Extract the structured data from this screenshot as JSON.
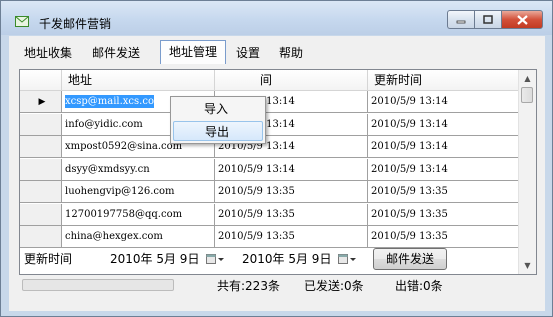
{
  "window": {
    "title": "千发邮件营销"
  },
  "menu": [
    "地址收集",
    "邮件发送",
    "地址管理",
    "设置",
    "帮助"
  ],
  "dropdown": [
    "导入",
    "导出"
  ],
  "table": {
    "columns": [
      "地址",
      "间",
      "更新时间"
    ],
    "rows": [
      {
        "email": "xcsp@mail.xcs.co",
        "col2": "2010/5/9 13:14",
        "col3": "2010/5/9 13:14",
        "selected": true
      },
      {
        "email": "info@yidic.com",
        "col2": "2010/5/9 13:14",
        "col3": "2010/5/9 13:14"
      },
      {
        "email": "xmpost0592@sina.com",
        "col2": "2010/5/9 13:14",
        "col3": "2010/5/9 13:14"
      },
      {
        "email": "dsyy@xmdsyy.cn",
        "col2": "2010/5/9 13:14",
        "col3": "2010/5/9 13:14"
      },
      {
        "email": "luohengvip@126.com",
        "col2": "2010/5/9 13:35",
        "col3": "2010/5/9 13:35"
      },
      {
        "email": "12700197758@qq.com",
        "col2": "2010/5/9 13:35",
        "col3": "2010/5/9 13:35"
      },
      {
        "email": "china@hexgex.com",
        "col2": "2010/5/9 13:35",
        "col3": "2010/5/9 13:35"
      }
    ]
  },
  "filter": {
    "label": "更新时间",
    "date_from": "2010年 5月 9日",
    "date_to": "2010年 5月 9日",
    "send_button": "邮件发送"
  },
  "status": {
    "total": "共有:223条",
    "sent": "已发送:0条",
    "errors": "出错:0条",
    "progress": 0
  }
}
